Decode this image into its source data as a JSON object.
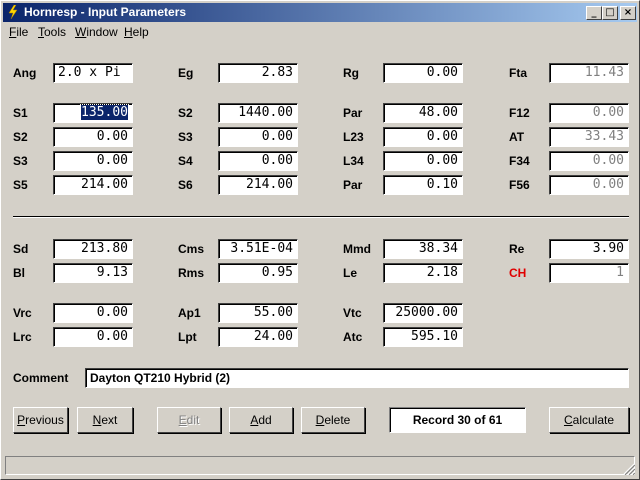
{
  "window": {
    "title": "Hornresp - Input Parameters"
  },
  "menu": [
    {
      "label": "File",
      "accel": "F",
      "rest": "ile"
    },
    {
      "label": "Tools",
      "accel": "T",
      "rest": "ools"
    },
    {
      "label": "Window",
      "accel": "W",
      "rest": "indow"
    },
    {
      "label": "Help",
      "accel": "H",
      "rest": "elp"
    }
  ],
  "params": {
    "ang": {
      "label": "Ang",
      "value": "2.0 x Pi"
    },
    "eg": {
      "label": "Eg",
      "value": "2.83"
    },
    "rg": {
      "label": "Rg",
      "value": "0.00"
    },
    "fta": {
      "label": "Fta",
      "value": "11.43"
    },
    "s1": {
      "label": "S1",
      "value": "135.00"
    },
    "s2b": {
      "label": "S2",
      "value": "1440.00"
    },
    "par1": {
      "label": "Par",
      "value": "48.00"
    },
    "f12": {
      "label": "F12",
      "value": "0.00"
    },
    "s2": {
      "label": "S2",
      "value": "0.00"
    },
    "s3b": {
      "label": "S3",
      "value": "0.00"
    },
    "l23": {
      "label": "L23",
      "value": "0.00"
    },
    "at": {
      "label": "AT",
      "value": "33.43"
    },
    "s3": {
      "label": "S3",
      "value": "0.00"
    },
    "s4": {
      "label": "S4",
      "value": "0.00"
    },
    "l34": {
      "label": "L34",
      "value": "0.00"
    },
    "f34": {
      "label": "F34",
      "value": "0.00"
    },
    "s5": {
      "label": "S5",
      "value": "214.00"
    },
    "s6": {
      "label": "S6",
      "value": "214.00"
    },
    "par2": {
      "label": "Par",
      "value": "0.10"
    },
    "f56": {
      "label": "F56",
      "value": "0.00"
    },
    "sd": {
      "label": "Sd",
      "value": "213.80"
    },
    "cms": {
      "label": "Cms",
      "value": "3.51E-04"
    },
    "mmd": {
      "label": "Mmd",
      "value": "38.34"
    },
    "re": {
      "label": "Re",
      "value": "3.90"
    },
    "bl": {
      "label": "Bl",
      "value": "9.13"
    },
    "rms": {
      "label": "Rms",
      "value": "0.95"
    },
    "le": {
      "label": "Le",
      "value": "2.18"
    },
    "ch": {
      "label": "CH",
      "value": "1"
    },
    "vrc": {
      "label": "Vrc",
      "value": "0.00"
    },
    "ap1": {
      "label": "Ap1",
      "value": "55.00"
    },
    "vtc": {
      "label": "Vtc",
      "value": "25000.00"
    },
    "lrc": {
      "label": "Lrc",
      "value": "0.00"
    },
    "lpt": {
      "label": "Lpt",
      "value": "24.00"
    },
    "atc": {
      "label": "Atc",
      "value": "595.10"
    }
  },
  "comment": {
    "label": "Comment",
    "value": "Dayton QT210 Hybrid (2)"
  },
  "buttons": {
    "previous": {
      "accel": "P",
      "rest": "revious"
    },
    "next": {
      "accel": "N",
      "rest": "ext"
    },
    "edit": {
      "accel": "E",
      "rest": "dit"
    },
    "add": {
      "accel": "A",
      "rest": "dd"
    },
    "delete": {
      "accel": "D",
      "rest": "elete"
    },
    "calculate": {
      "accel": "C",
      "rest": "alculate"
    }
  },
  "record": "Record 30 of 61",
  "colors": {
    "title_start": "#0a246a",
    "title_end": "#a6caf0",
    "selection": "#0a246a",
    "ch_label": "#e00000"
  }
}
